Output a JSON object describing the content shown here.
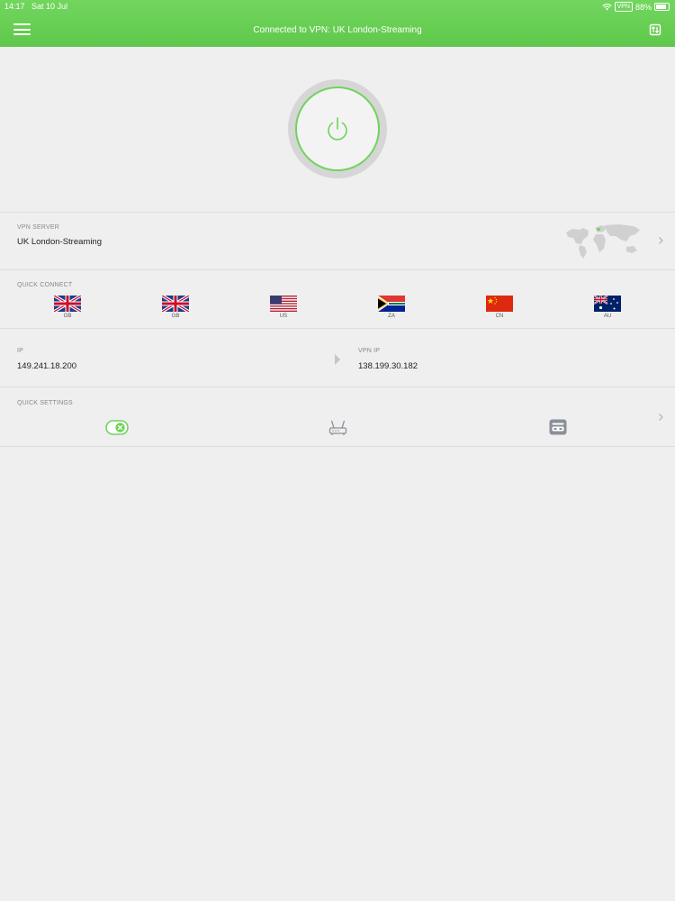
{
  "status_bar": {
    "time": "14:17",
    "date": "Sat 10 Jul",
    "vpn_badge": "VPN",
    "battery": "88%"
  },
  "header": {
    "title": "Connected to VPN: UK London-Streaming"
  },
  "vpn_server": {
    "label": "VPN SERVER",
    "value": "UK London-Streaming"
  },
  "quick_connect": {
    "label": "QUICK CONNECT",
    "items": [
      {
        "code": "GB",
        "flag": "uk-flag-icon"
      },
      {
        "code": "GB",
        "flag": "uk-flag-icon"
      },
      {
        "code": "US",
        "flag": "us-flag-icon"
      },
      {
        "code": "ZA",
        "flag": "za-flag-icon"
      },
      {
        "code": "CN",
        "flag": "cn-flag-icon"
      },
      {
        "code": "AU",
        "flag": "au-flag-icon"
      }
    ]
  },
  "ip": {
    "label": "IP",
    "value": "149.241.18.200",
    "vpn_label": "VPN IP",
    "vpn_value": "138.199.30.182"
  },
  "quick_settings": {
    "label": "QUICK SETTINGS",
    "items": [
      {
        "icon": "kill-switch-toggle-icon"
      },
      {
        "icon": "router-icon"
      },
      {
        "icon": "adblock-icon"
      }
    ]
  },
  "colors": {
    "accent": "#6fd35a",
    "header": "#64cb50"
  }
}
